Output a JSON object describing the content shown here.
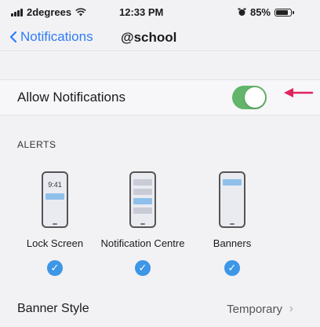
{
  "status": {
    "carrier": "2degrees",
    "time": "12:33 PM",
    "battery_pct": "85%",
    "battery_level": 0.85
  },
  "nav": {
    "back_label": "Notifications",
    "title": "@school"
  },
  "allow": {
    "label": "Allow Notifications",
    "enabled": true
  },
  "alerts": {
    "header": "ALERTS",
    "options": [
      {
        "label": "Lock Screen",
        "checked": true,
        "time": "9:41"
      },
      {
        "label": "Notification Centre",
        "checked": true
      },
      {
        "label": "Banners",
        "checked": true
      }
    ]
  },
  "banner_style": {
    "label": "Banner Style",
    "value": "Temporary"
  },
  "colors": {
    "accent": "#2f7df6",
    "toggle_on": "#62b56a",
    "arrow": "#e0245e",
    "check": "#3d96e6"
  }
}
